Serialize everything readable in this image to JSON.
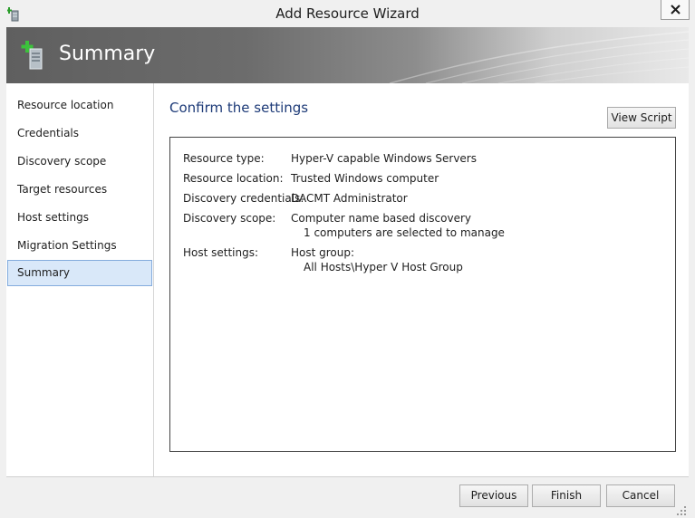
{
  "window": {
    "title": "Add Resource Wizard",
    "close_icon": "close-icon",
    "app_icon": "add-resource-icon"
  },
  "banner": {
    "title": "Summary",
    "icon": "add-server-icon"
  },
  "nav": {
    "items": [
      {
        "label": "Resource location",
        "selected": false
      },
      {
        "label": "Credentials",
        "selected": false
      },
      {
        "label": "Discovery scope",
        "selected": false
      },
      {
        "label": "Target resources",
        "selected": false
      },
      {
        "label": "Host settings",
        "selected": false
      },
      {
        "label": "Migration Settings",
        "selected": false
      },
      {
        "label": "Summary",
        "selected": true
      }
    ]
  },
  "main": {
    "heading": "Confirm the settings",
    "view_script_label": "View Script",
    "summary": {
      "resource_type": {
        "label": "Resource type:",
        "value": "Hyper-V capable Windows Servers"
      },
      "resource_location": {
        "label": "Resource location:",
        "value": "Trusted Windows computer"
      },
      "discovery_credentials": {
        "label": "Discovery credentials:",
        "value": "DACMT Administrator"
      },
      "discovery_scope": {
        "label": "Discovery scope:",
        "value": "Computer name based discovery",
        "detail": "1 computers are selected to manage"
      },
      "host_settings": {
        "label": "Host settings:",
        "value": "Host group:",
        "detail": "All Hosts\\Hyper V Host Group"
      }
    }
  },
  "footer": {
    "previous_label": "Previous",
    "finish_label": "Finish",
    "cancel_label": "Cancel"
  },
  "colors": {
    "heading": "#1e3b78",
    "nav_selected_bg": "#d9e8f9",
    "nav_selected_border": "#84acdd"
  }
}
